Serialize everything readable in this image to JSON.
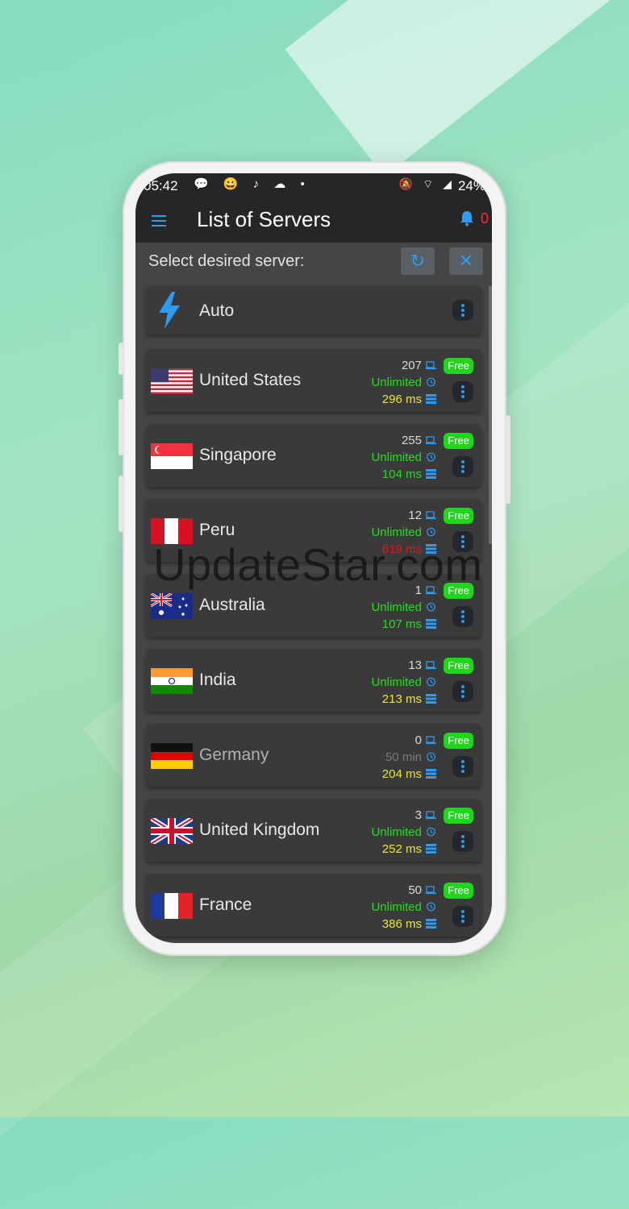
{
  "status_bar": {
    "time": "05:42",
    "left_icons": "💬 😀 ♪ ☁ •",
    "right_icons": "🔕 ⌔ ◢",
    "battery": "24%"
  },
  "app_bar": {
    "title": "List of Servers",
    "notification_count": "0"
  },
  "subheader": {
    "label": "Select desired server:",
    "refresh_icon": "↻",
    "close_icon": "✕"
  },
  "auto": {
    "label": "Auto"
  },
  "servers": [
    {
      "name": "United States",
      "flag": "us",
      "users": "207",
      "duration": "Unlimited",
      "ping": "296 ms",
      "ping_color": "yellow",
      "badge": "Free"
    },
    {
      "name": "Singapore",
      "flag": "sg",
      "users": "255",
      "duration": "Unlimited",
      "ping": "104 ms",
      "ping_color": "green",
      "badge": "Free"
    },
    {
      "name": "Peru",
      "flag": "pe",
      "users": "12",
      "duration": "Unlimited",
      "ping": "619 ms",
      "ping_color": "red",
      "badge": "Free"
    },
    {
      "name": "Australia",
      "flag": "au",
      "users": "1",
      "duration": "Unlimited",
      "ping": "107 ms",
      "ping_color": "green",
      "badge": "Free"
    },
    {
      "name": "India",
      "flag": "in",
      "users": "13",
      "duration": "Unlimited",
      "ping": "213 ms",
      "ping_color": "yellow",
      "badge": "Free"
    },
    {
      "name": "Germany",
      "flag": "de",
      "users": "0",
      "duration": "50 min",
      "ping": "204 ms",
      "ping_color": "yellow",
      "badge": "Free",
      "dimmed": true
    },
    {
      "name": "United Kingdom",
      "flag": "gb",
      "users": "3",
      "duration": "Unlimited",
      "ping": "252 ms",
      "ping_color": "yellow",
      "badge": "Free"
    },
    {
      "name": "France",
      "flag": "fr",
      "users": "50",
      "duration": "Unlimited",
      "ping": "386 ms",
      "ping_color": "yellow",
      "badge": "Free"
    }
  ],
  "watermark": "UpdateStar.com",
  "colors": {
    "accent": "#2d9bf0",
    "free_badge": "#1ed61a",
    "unlimited": "#22e01a",
    "ping_yellow": "#e9e637",
    "ping_red": "#e01818"
  }
}
